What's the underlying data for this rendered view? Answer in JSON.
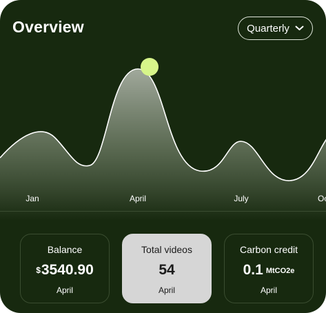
{
  "header": {
    "title": "Overview",
    "period_selector": "Quarterly",
    "period_icon": "chevron-down-icon"
  },
  "colors": {
    "background": "#17290f",
    "line": "#ffffff",
    "highlight_marker": "#d7f58a",
    "active_card": "#d6d6d6"
  },
  "chart_data": {
    "type": "area",
    "categories": [
      "Jan",
      "April",
      "July",
      "Oc"
    ],
    "highlighted": "April",
    "grid": false,
    "title": "",
    "xlabel": "",
    "ylabel": ""
  },
  "stats": [
    {
      "label": "Balance",
      "currency": "$",
      "value": "3540.90",
      "unit": "",
      "period": "April"
    },
    {
      "label": "Total videos",
      "currency": "",
      "value": "54",
      "unit": "",
      "period": "April"
    },
    {
      "label": "Carbon credit",
      "currency": "",
      "value": "0.1",
      "unit": "MtCO2e",
      "period": "April"
    }
  ]
}
